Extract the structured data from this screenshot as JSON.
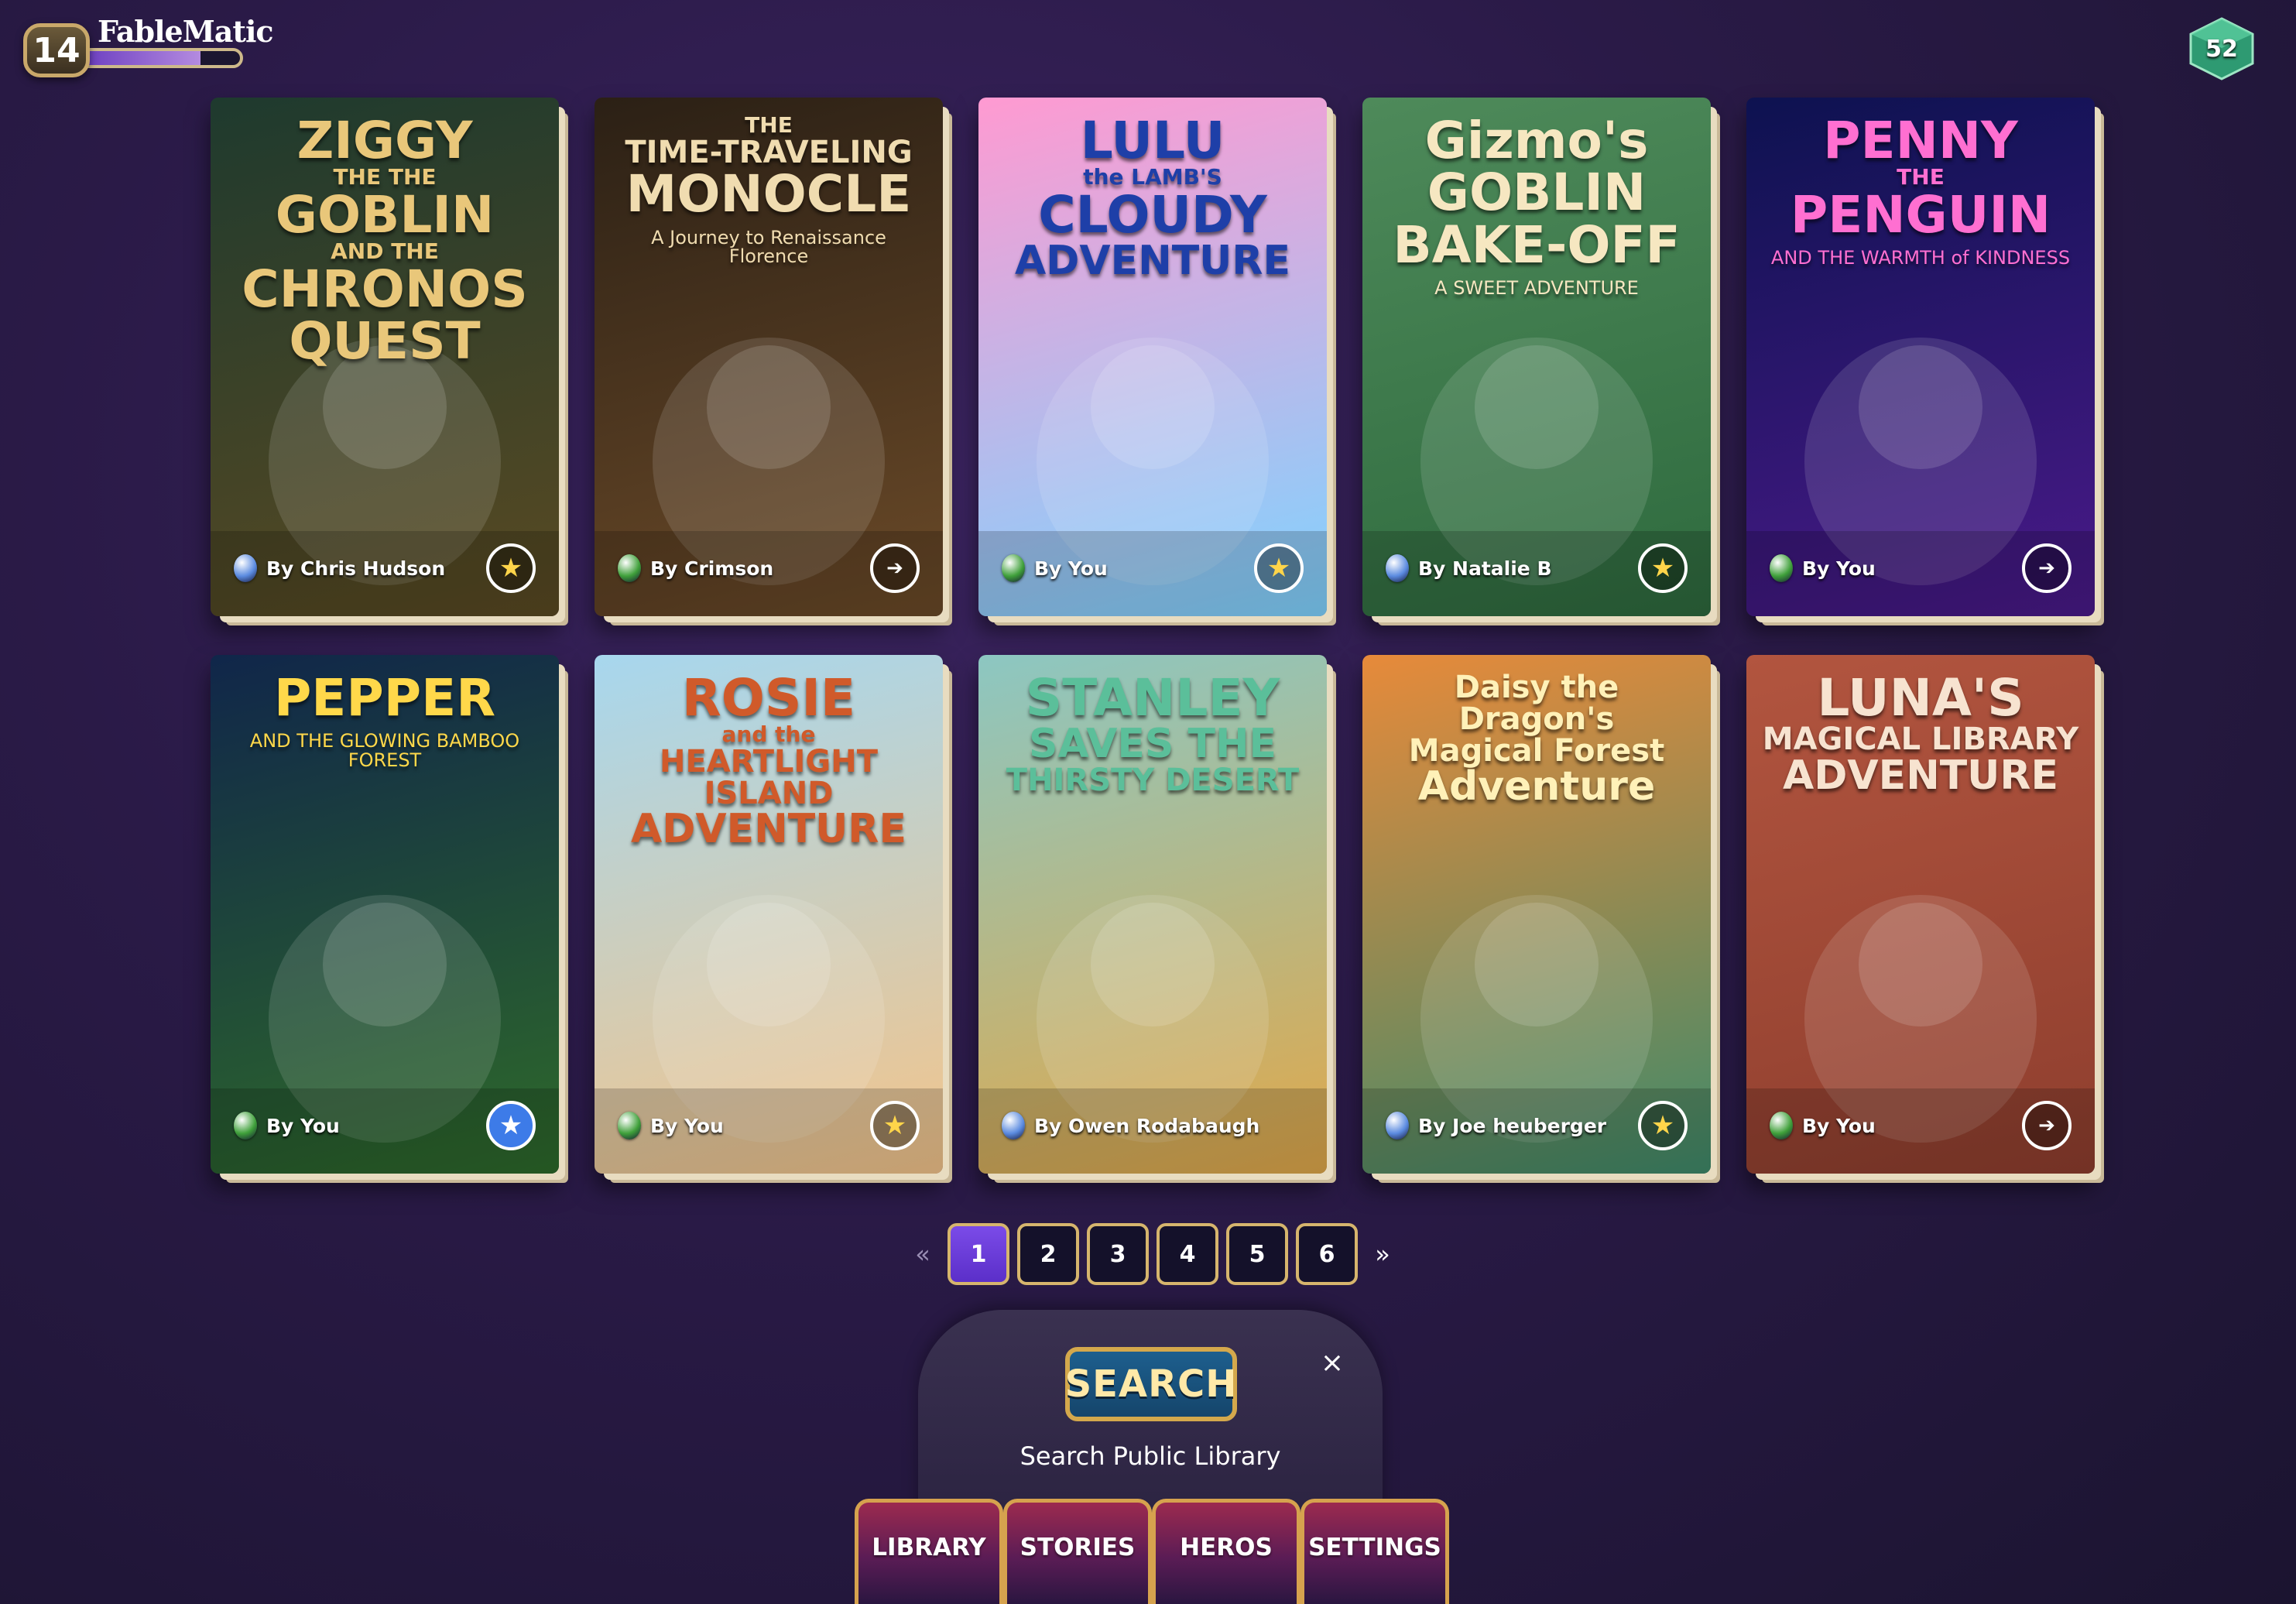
{
  "header": {
    "level": "14",
    "brand": "FableMatic",
    "xp_progress_percent": 75,
    "gems": "52"
  },
  "books": [
    {
      "title": "ZIGGY",
      "title_lines": [
        "ZIGGY",
        "THE THE",
        "GOBLIN",
        "AND THE",
        "CHRONOS",
        "QUEST"
      ],
      "subtitle": "",
      "author": "By Chris Hudson",
      "badge": "star",
      "palette": [
        "#1e3a2e",
        "#5a4a22"
      ],
      "title_color": "#e9c77a",
      "author_icon": "#5b8be0"
    },
    {
      "title": "THE TIME-TRAVELING MONOCLE",
      "title_lines": [
        "THE",
        "TIME-TRAVELING",
        "MONOCLE"
      ],
      "subtitle": "A Journey to Renaissance Florence",
      "author": "By Crimson",
      "badge": "play",
      "palette": [
        "#2b2015",
        "#6b4a28"
      ],
      "title_color": "#f0dcb0",
      "author_icon": "#3fa03a"
    },
    {
      "title": "LULU the LAMB'S CLOUDY ADVENTURE",
      "title_lines": [
        "LULU",
        "the LAMB'S",
        "CLOUDY",
        "ADVENTURE"
      ],
      "subtitle": "",
      "author": "By You",
      "badge": "star",
      "palette": [
        "#ff9ad1",
        "#7fd3ff"
      ],
      "title_color": "#1e3fa8",
      "author_icon": "#3fa03a"
    },
    {
      "title": "Gizmo's GOBLIN BAKE-OFF",
      "title_lines": [
        "Gizmo's",
        "GOBLIN",
        "BAKE-OFF"
      ],
      "subtitle": "A SWEET ADVENTURE",
      "author": "By Natalie B",
      "badge": "star",
      "palette": [
        "#4e8a5a",
        "#2e6a3e"
      ],
      "title_color": "#f6e7c1",
      "author_icon": "#5b8be0"
    },
    {
      "title": "PENNY THE PENGUIN",
      "title_lines": [
        "PENNY",
        "THE",
        "PENGUIN"
      ],
      "subtitle": "AND THE WARMTH of KINDNESS",
      "author": "By You",
      "badge": "play",
      "palette": [
        "#0d1250",
        "#4a1a8a"
      ],
      "title_color": "#ff6fd1",
      "author_icon": "#3fa03a"
    },
    {
      "title": "PEPPER",
      "title_lines": [
        "PEPPER"
      ],
      "subtitle": "AND THE GLOWING BAMBOO FOREST",
      "author": "By You",
      "badge": "star-blue",
      "palette": [
        "#10264a",
        "#2e6a2a"
      ],
      "title_color": "#ffd84a",
      "author_icon": "#3fa03a"
    },
    {
      "title": "Rosie and the Heartlight Island Adventure",
      "title_lines": [
        "ROSIE",
        "and the",
        "HEARTLIGHT ISLAND",
        "ADVENTURE"
      ],
      "subtitle": "",
      "author": "By You",
      "badge": "star",
      "palette": [
        "#a7d7ee",
        "#f3c48a"
      ],
      "title_color": "#d05a2a",
      "author_icon": "#3fa03a"
    },
    {
      "title": "STANLEY SAVES THE THIRSTY DESERT",
      "title_lines": [
        "STANLEY",
        "SAVES THE",
        "THIRSTY DESERT"
      ],
      "subtitle": "",
      "author": "By Owen Rodabaugh",
      "badge": "none",
      "palette": [
        "#8cc7c2",
        "#e0a84a"
      ],
      "title_color": "#5bbf9a",
      "author_icon": "#5b8be0"
    },
    {
      "title": "Daisy the Dragon's Magical Forest Adventure",
      "title_lines": [
        "Daisy the Dragon's",
        "Magical Forest",
        "Adventure"
      ],
      "subtitle": "",
      "author": "By Joe heuberger",
      "badge": "star",
      "palette": [
        "#e78a3a",
        "#3f8a6a"
      ],
      "title_color": "#fff1b8",
      "author_icon": "#5b8be0"
    },
    {
      "title": "LUNA'S MAGICAL LIBRARY ADVENTURE",
      "title_lines": [
        "LUNA'S",
        "MAGICAL LIBRARY",
        "ADVENTURE"
      ],
      "subtitle": "",
      "author": "By You",
      "badge": "play",
      "palette": [
        "#b2553f",
        "#8e3e2e"
      ],
      "title_color": "#f7e3d0",
      "author_icon": "#3fa03a"
    }
  ],
  "pagination": {
    "prev": "«",
    "next": "»",
    "pages": [
      "1",
      "2",
      "3",
      "4",
      "5",
      "6"
    ],
    "current": "1"
  },
  "search": {
    "button_label": "SEARCH",
    "close": "×",
    "caption": "Search Public Library"
  },
  "nav": {
    "tabs": [
      "LIBRARY",
      "STORIES",
      "HEROS",
      "SETTINGS"
    ]
  }
}
